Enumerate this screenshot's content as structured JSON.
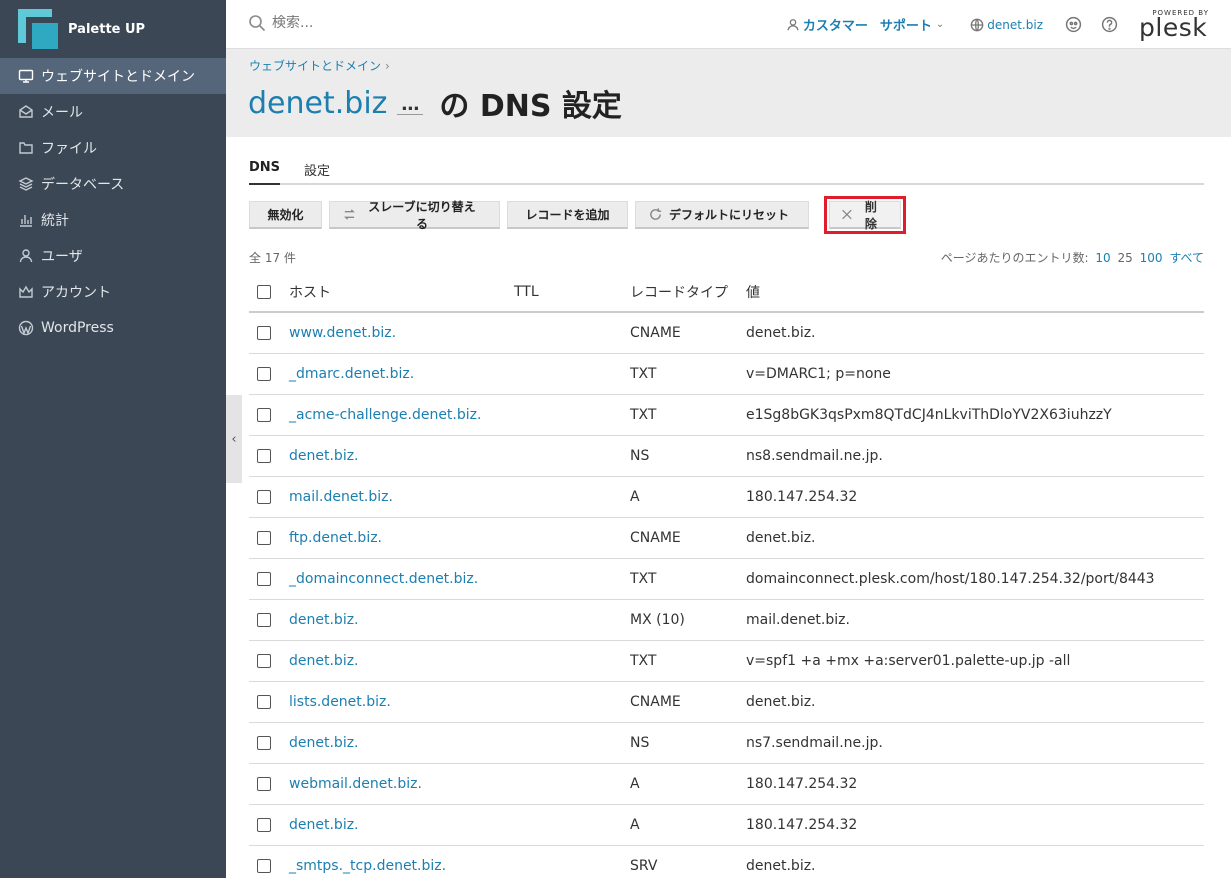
{
  "brand": {
    "name": "Palette UP",
    "accent": "#5fc8d9"
  },
  "sidebar": {
    "items": [
      {
        "label": "ウェブサイトとドメイン",
        "icon": "monitor-icon",
        "active": true
      },
      {
        "label": "メール",
        "icon": "mail-icon",
        "active": false
      },
      {
        "label": "ファイル",
        "icon": "folder-icon",
        "active": false
      },
      {
        "label": "データベース",
        "icon": "database-icon",
        "active": false
      },
      {
        "label": "統計",
        "icon": "bar-chart-icon",
        "active": false
      },
      {
        "label": "ユーザ",
        "icon": "user-icon",
        "active": false
      },
      {
        "label": "アカウント",
        "icon": "crown-icon",
        "active": false
      },
      {
        "label": "WordPress",
        "icon": "wordpress-icon",
        "active": false
      }
    ]
  },
  "topbar": {
    "search_placeholder": "検索...",
    "customer": "カスタマー",
    "support": "サポート",
    "domain": "denet.biz",
    "powered_by": "POWERED BY",
    "plesk": "plesk"
  },
  "header": {
    "breadcrumb": "ウェブサイトとドメイン",
    "title_domain": "denet.biz",
    "title_more": "…",
    "title_rest": "の DNS 設定"
  },
  "tabs": [
    {
      "label": "DNS",
      "active": true
    },
    {
      "label": "設定",
      "active": false
    }
  ],
  "toolbar": {
    "disable": "無効化",
    "switch_slave": "スレーブに切り替える",
    "add_record": "レコードを追加",
    "reset_default": "デフォルトにリセット",
    "delete": "削除",
    "highlight_color": "#e01d2a"
  },
  "list": {
    "count": "全 17 件",
    "perpage_label": "ページあたりのエントリ数:",
    "perpage_options": [
      "10",
      "25",
      "100",
      "すべて"
    ],
    "headers": {
      "host": "ホスト",
      "ttl": "TTL",
      "type": "レコードタイプ",
      "value": "値"
    },
    "rows": [
      {
        "host": "www.denet.biz.",
        "ttl": "",
        "type": "CNAME",
        "value": "denet.biz."
      },
      {
        "host": "_dmarc.denet.biz.",
        "ttl": "",
        "type": "TXT",
        "value": "v=DMARC1; p=none"
      },
      {
        "host": "_acme-challenge.denet.biz.",
        "ttl": "",
        "type": "TXT",
        "value": "e1Sg8bGK3qsPxm8QTdCJ4nLkviThDloYV2X63iuhzzY"
      },
      {
        "host": "denet.biz.",
        "ttl": "",
        "type": "NS",
        "value": "ns8.sendmail.ne.jp."
      },
      {
        "host": "mail.denet.biz.",
        "ttl": "",
        "type": "A",
        "value": "180.147.254.32"
      },
      {
        "host": "ftp.denet.biz.",
        "ttl": "",
        "type": "CNAME",
        "value": "denet.biz."
      },
      {
        "host": "_domainconnect.denet.biz.",
        "ttl": "",
        "type": "TXT",
        "value": "domainconnect.plesk.com/host/180.147.254.32/port/8443"
      },
      {
        "host": "denet.biz.",
        "ttl": "",
        "type": "MX (10)",
        "value": "mail.denet.biz."
      },
      {
        "host": "denet.biz.",
        "ttl": "",
        "type": "TXT",
        "value": "v=spf1 +a +mx +a:server01.palette-up.jp -all"
      },
      {
        "host": "lists.denet.biz.",
        "ttl": "",
        "type": "CNAME",
        "value": "denet.biz."
      },
      {
        "host": "denet.biz.",
        "ttl": "",
        "type": "NS",
        "value": "ns7.sendmail.ne.jp."
      },
      {
        "host": "webmail.denet.biz.",
        "ttl": "",
        "type": "A",
        "value": "180.147.254.32"
      },
      {
        "host": "denet.biz.",
        "ttl": "",
        "type": "A",
        "value": "180.147.254.32"
      },
      {
        "host": "_smtps._tcp.denet.biz.",
        "ttl": "",
        "type": "SRV",
        "value": "denet.biz."
      }
    ]
  }
}
